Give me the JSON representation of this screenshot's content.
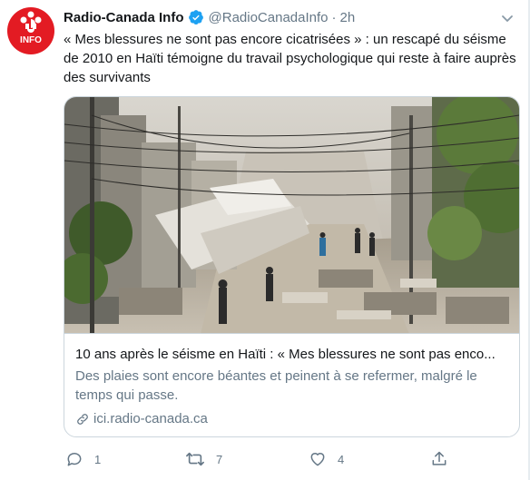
{
  "account": {
    "name": "Radio-Canada Info",
    "handle": "@RadioCanadaInfo",
    "separator": "·",
    "time": "2h",
    "avatar_text": "INFO"
  },
  "tweet": {
    "text": "« Mes blessures ne sont pas encore cicatrisées » : un rescapé du séisme de 2010 en Haïti témoigne du travail psychologique qui reste à faire auprès des survivants"
  },
  "card": {
    "title": "10 ans après le séisme en Haïti : « Mes blessures ne sont pas enco...",
    "description": "Des plaies sont encore béantes et peinent à se refermer, malgré le temps qui passe.",
    "domain": "ici.radio-canada.ca"
  },
  "actions": {
    "reply_count": "1",
    "retweet_count": "7",
    "like_count": "4"
  },
  "colors": {
    "brand_red": "#e31b23",
    "verified_blue": "#1da1f2",
    "secondary_text": "#657786",
    "border": "#ccd6dd"
  }
}
